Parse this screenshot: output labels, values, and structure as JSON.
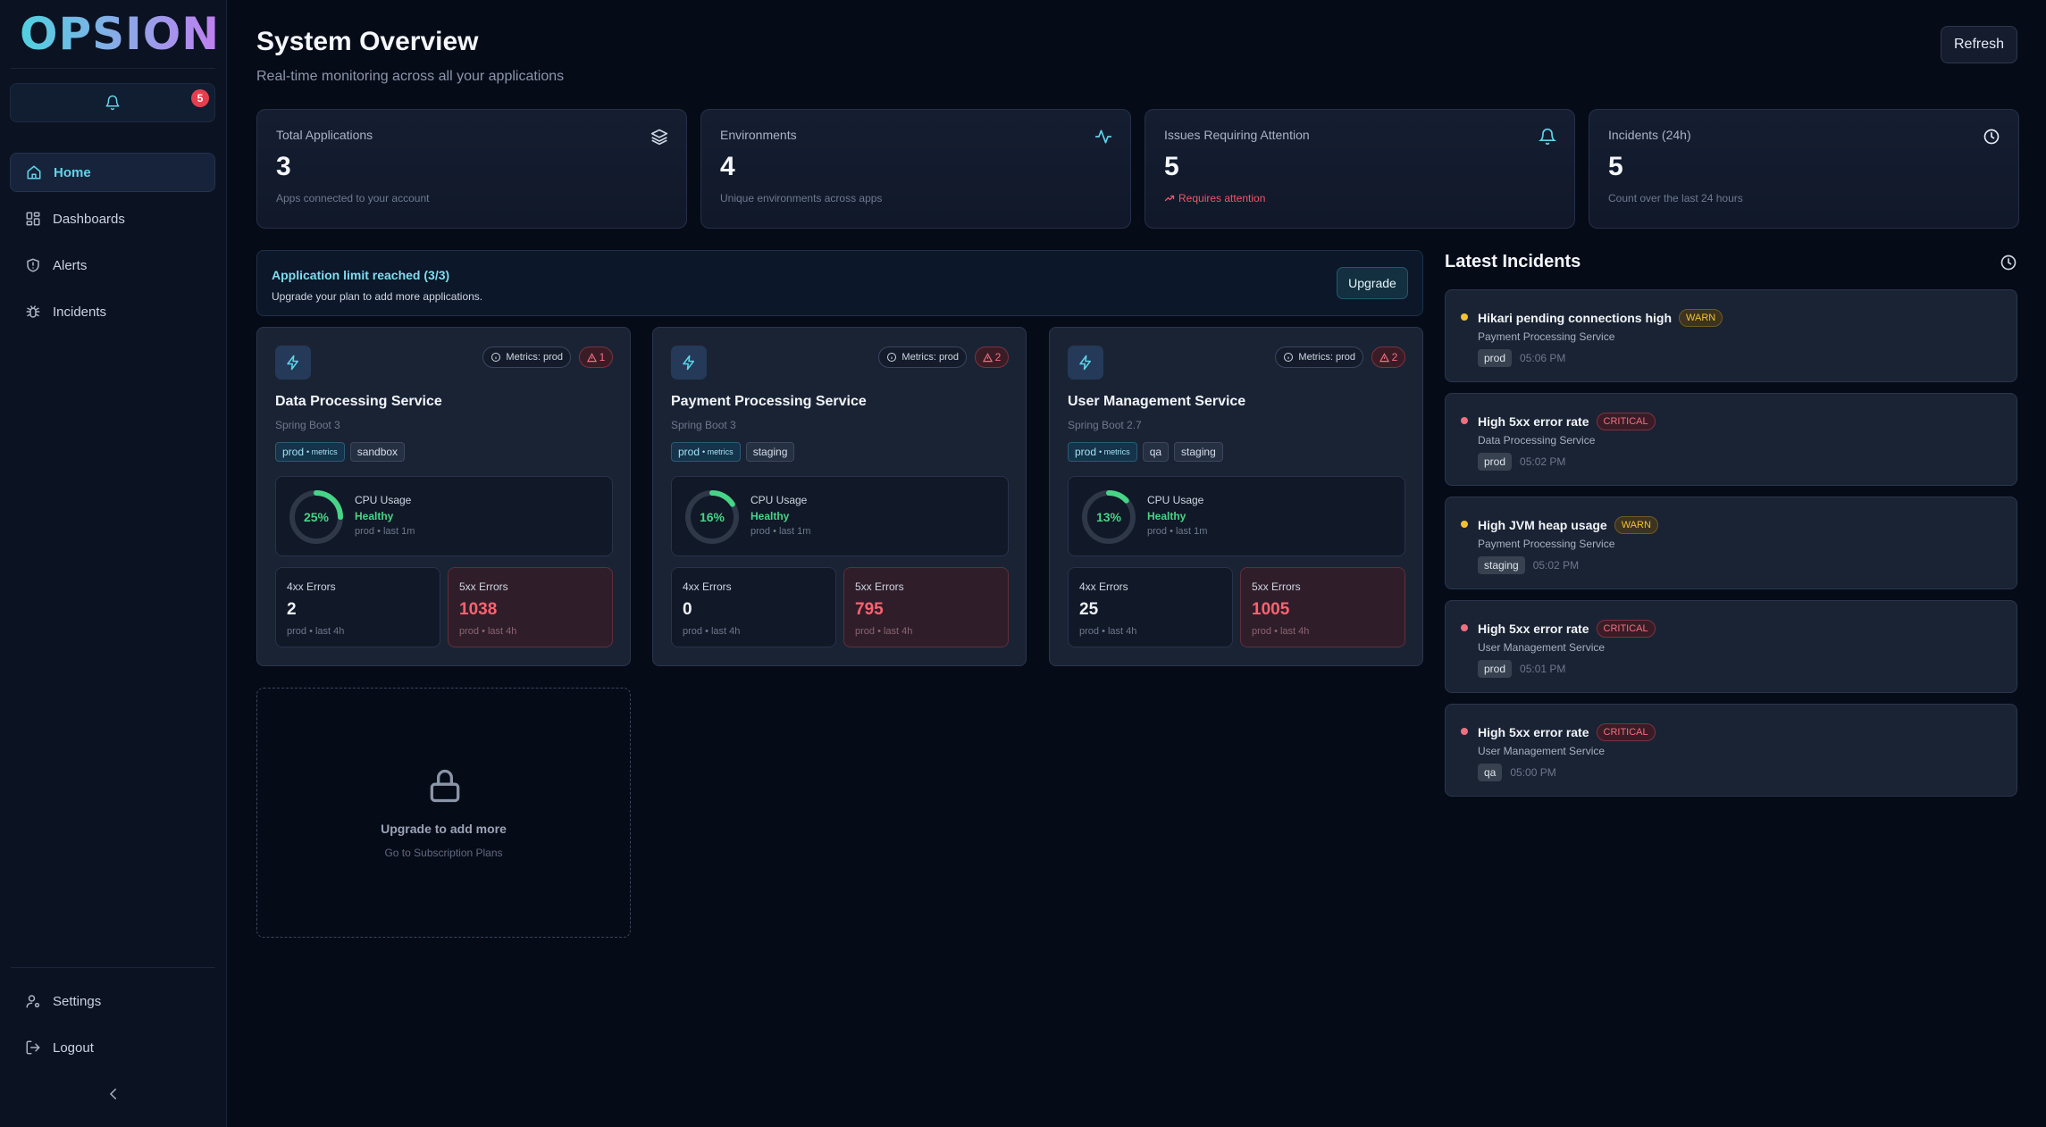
{
  "brand": {
    "logo_text": "OPSION"
  },
  "sidebar": {
    "notifications_count": "5",
    "nav": [
      {
        "label": "Home",
        "icon": "home-icon",
        "active": true
      },
      {
        "label": "Dashboards",
        "icon": "grid-icon"
      },
      {
        "label": "Alerts",
        "icon": "shield-icon"
      },
      {
        "label": "Incidents",
        "icon": "bug-icon"
      }
    ],
    "bottom": [
      {
        "label": "Settings",
        "icon": "user-settings-icon"
      },
      {
        "label": "Logout",
        "icon": "logout-icon"
      }
    ]
  },
  "header": {
    "title": "System Overview",
    "subtitle": "Real-time monitoring across all your applications",
    "refresh_label": "Refresh"
  },
  "stats": [
    {
      "label": "Total Applications",
      "value": "3",
      "sub": "Apps connected to your account",
      "icon": "layers-icon"
    },
    {
      "label": "Environments",
      "value": "4",
      "sub": "Unique environments across apps",
      "icon": "activity-icon"
    },
    {
      "label": "Issues Requiring Attention",
      "value": "5",
      "sub": "Requires attention",
      "icon": "bell-icon"
    },
    {
      "label": "Incidents (24h)",
      "value": "5",
      "sub": "Count over the last 24 hours",
      "icon": "clock-icon"
    }
  ],
  "banner": {
    "title": "Application limit reached (3/3)",
    "text": "Upgrade your plan to add more applications.",
    "button": "Upgrade"
  },
  "apps": [
    {
      "name": "Data Processing Service",
      "framework": "Spring Boot 3",
      "metrics_label": "Metrics: prod",
      "warnings": "1",
      "tags": [
        {
          "label": "prod",
          "metrics": "• metrics"
        },
        {
          "label": "sandbox"
        }
      ],
      "cpu": {
        "percent": 25,
        "percent_text": "25%",
        "label": "CPU Usage",
        "status": "Healthy",
        "sub": "prod • last 1m"
      },
      "errors4xx": {
        "label": "4xx Errors",
        "value": "2",
        "sub": "prod • last 4h"
      },
      "errors5xx": {
        "label": "5xx Errors",
        "value": "1038",
        "sub": "prod • last 4h"
      }
    },
    {
      "name": "Payment Processing Service",
      "framework": "Spring Boot 3",
      "metrics_label": "Metrics: prod",
      "warnings": "2",
      "tags": [
        {
          "label": "prod",
          "metrics": "• metrics"
        },
        {
          "label": "staging"
        }
      ],
      "cpu": {
        "percent": 16,
        "percent_text": "16%",
        "label": "CPU Usage",
        "status": "Healthy",
        "sub": "prod • last 1m"
      },
      "errors4xx": {
        "label": "4xx Errors",
        "value": "0",
        "sub": "prod • last 4h"
      },
      "errors5xx": {
        "label": "5xx Errors",
        "value": "795",
        "sub": "prod • last 4h"
      }
    },
    {
      "name": "User Management Service",
      "framework": "Spring Boot 2.7",
      "metrics_label": "Metrics: prod",
      "warnings": "2",
      "tags": [
        {
          "label": "prod",
          "metrics": "• metrics"
        },
        {
          "label": "qa"
        },
        {
          "label": "staging"
        }
      ],
      "cpu": {
        "percent": 13,
        "percent_text": "13%",
        "label": "CPU Usage",
        "status": "Healthy",
        "sub": "prod • last 1m"
      },
      "errors4xx": {
        "label": "4xx Errors",
        "value": "25",
        "sub": "prod • last 4h"
      },
      "errors5xx": {
        "label": "5xx Errors",
        "value": "1005",
        "sub": "prod • last 4h"
      }
    }
  ],
  "upgrade_card": {
    "title": "Upgrade to add more",
    "subtitle": "Go to Subscription Plans"
  },
  "incidents_panel": {
    "title": "Latest Incidents",
    "items": [
      {
        "title": "Hikari pending connections high",
        "severity": "WARN",
        "level": "warn",
        "service": "Payment Processing Service",
        "env": "prod",
        "time": "05:06 PM"
      },
      {
        "title": "High 5xx error rate",
        "severity": "CRITICAL",
        "level": "crit",
        "service": "Data Processing Service",
        "env": "prod",
        "time": "05:02 PM"
      },
      {
        "title": "High JVM heap usage",
        "severity": "WARN",
        "level": "warn",
        "service": "Payment Processing Service",
        "env": "staging",
        "time": "05:02 PM"
      },
      {
        "title": "High 5xx error rate",
        "severity": "CRITICAL",
        "level": "crit",
        "service": "User Management Service",
        "env": "prod",
        "time": "05:01 PM"
      },
      {
        "title": "High 5xx error rate",
        "severity": "CRITICAL",
        "level": "crit",
        "service": "User Management Service",
        "env": "qa",
        "time": "05:00 PM"
      }
    ]
  },
  "colors": {
    "accent": "#5fd4ea",
    "healthy": "#47d486",
    "critical": "#f07080",
    "warn": "#f2c232",
    "background": "#060b18"
  }
}
